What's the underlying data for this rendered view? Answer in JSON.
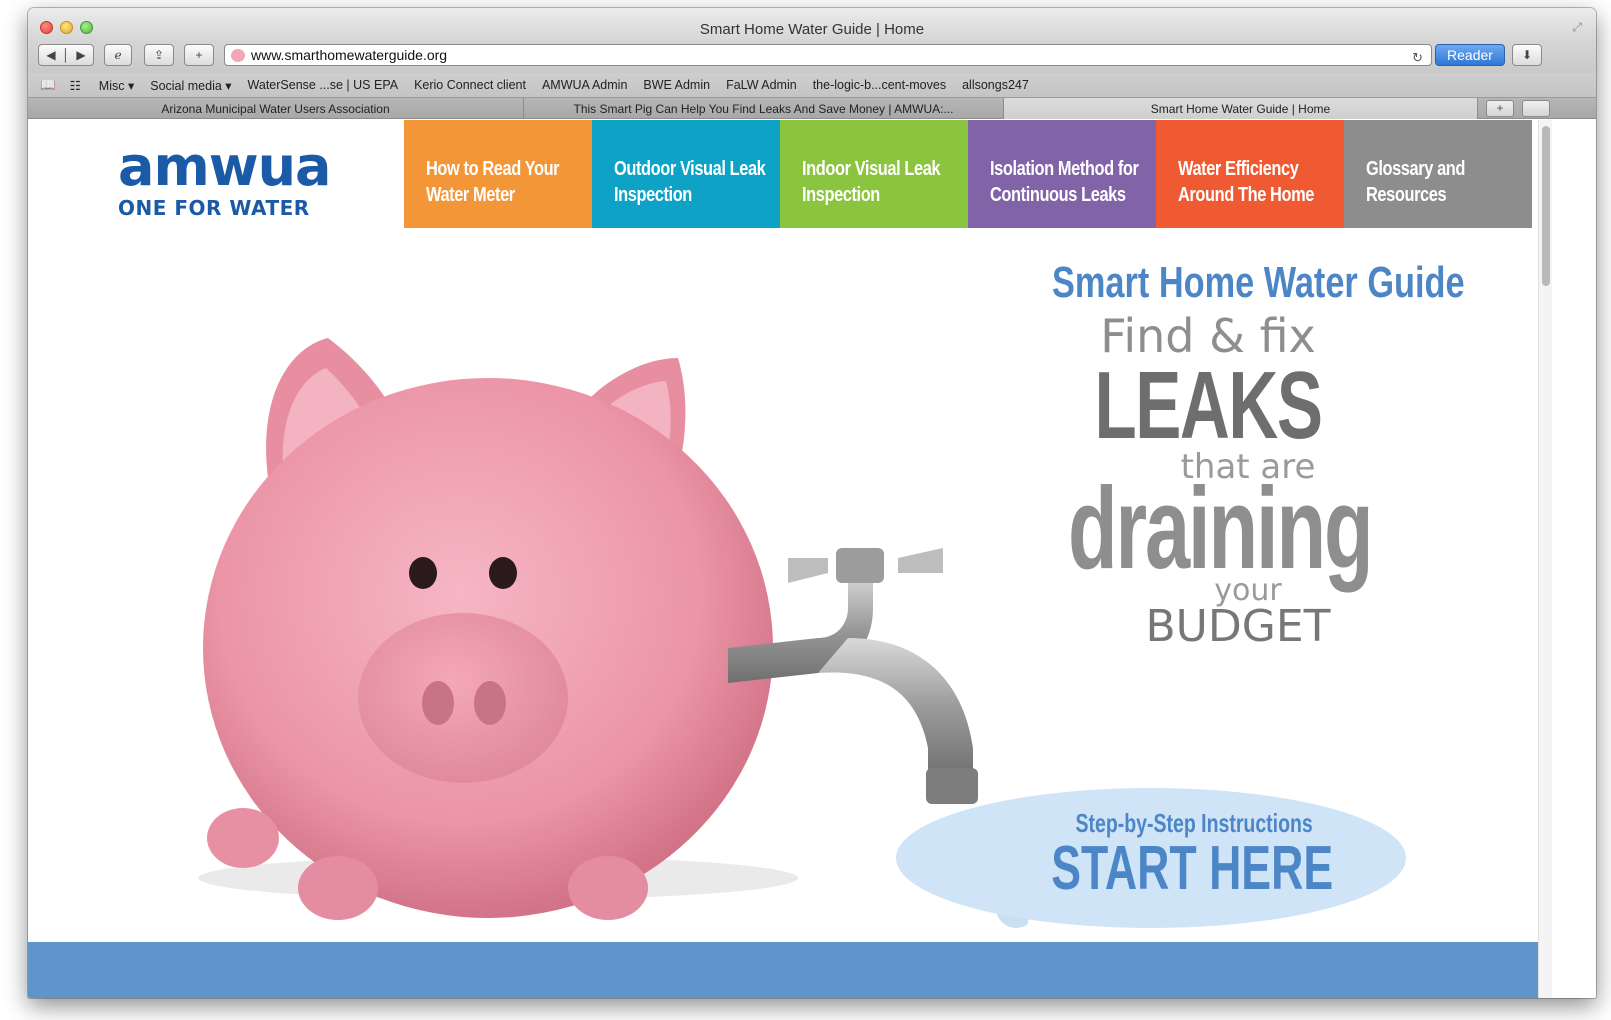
{
  "window": {
    "title": "Smart Home Water Guide | Home"
  },
  "toolbar": {
    "url": "www.smarthomewaterguide.org",
    "reader_label": "Reader"
  },
  "bookmarks": [
    "Misc ▾",
    "Social media ▾",
    "WaterSense ...se | US EPA",
    "Kerio Connect client",
    "AMWUA Admin",
    "BWE Admin",
    "FaLW Admin",
    "the-logic-b...cent-moves",
    "allsongs247"
  ],
  "tabs": [
    "Arizona Municipal Water Users Association",
    "This Smart Pig Can Help You Find Leaks And Save Money | AMWUA:...",
    "Smart Home Water Guide | Home"
  ],
  "logo": {
    "main": "amwua",
    "sub": "ONE FOR WATER"
  },
  "nav": [
    {
      "line1": "How to Read Your",
      "line2": "Water Meter",
      "color": "#f39638"
    },
    {
      "line1": "Outdoor Visual Leak",
      "line2": "Inspection",
      "color": "#0ea3c6"
    },
    {
      "line1": "Indoor Visual Leak",
      "line2": "Inspection",
      "color": "#8bc43f"
    },
    {
      "line1": "Isolation Method for",
      "line2": "Continuous Leaks",
      "color": "#8164a8"
    },
    {
      "line1": "Water Efficiency",
      "line2": "Around The Home",
      "color": "#ef5a33"
    },
    {
      "line1": "Glossary and",
      "line2": "Resources",
      "color": "#8d8d8d"
    }
  ],
  "hero": {
    "title": "Smart Home Water Guide",
    "find": "Find & fix",
    "leaks": "LEAKS",
    "that_are": "that are",
    "draining": "draining",
    "your": "your",
    "budget": "BUDGET",
    "start_sub": "Step-by-Step Instructions",
    "start_main": "START HERE"
  },
  "colors": {
    "brand_blue": "#1b5aa6",
    "accent_blue": "#4d86c6",
    "footer_band": "#5f95cd"
  }
}
